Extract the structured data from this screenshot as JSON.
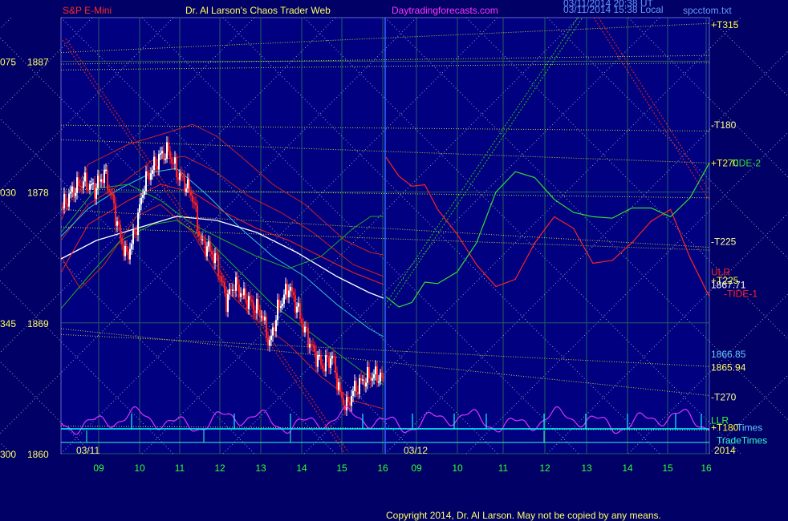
{
  "header": {
    "instrument": "S&P E-Mini",
    "author": "Dr. Al Larson's Chaos Trader Web",
    "site": "Daytradingforecasts.com",
    "stamp_ut": "03/11/2014 20:38 UT",
    "stamp_local": "03/11/2014 15:38 Local",
    "file": "spcctom.txt"
  },
  "footer": {
    "copyright": "Copyright 2014, Dr. Al Larson. May not be copied by any means."
  },
  "colors": {
    "background": "#000066",
    "plot_background": "#000080",
    "title_red": "#ff2a2a",
    "title_yellow": "#ffff66",
    "site_magenta": "#ff33ff",
    "label_yellow": "#ffff33",
    "tick_green": "#33ff33",
    "tide1": "#ff2222",
    "tide2": "#33dd33",
    "cycle": "#dd33ff",
    "trade_times": "#33ffcc",
    "lunar_cyan": "#00ffff"
  },
  "chart_data": {
    "type": "line",
    "y_ticks": [
      {
        "left": "075",
        "price": "1887",
        "value": 1887
      },
      {
        "left": "030",
        "price": "1878",
        "value": 1878
      },
      {
        "left": "345",
        "price": "1869",
        "value": 1869
      },
      {
        "left": "300",
        "price": "1860",
        "value": 1860
      }
    ],
    "ylim": [
      1860,
      1890
    ],
    "x_ticks_day1": [
      "09",
      "10",
      "11",
      "12",
      "13",
      "14",
      "15",
      "16"
    ],
    "x_ticks_day2": [
      "09",
      "10",
      "11",
      "12",
      "13",
      "14",
      "15",
      "16"
    ],
    "date_labels": [
      "03/11",
      "03/12"
    ],
    "year_label": "2014",
    "right_labels": [
      {
        "text": "+T315",
        "price": 1889.5,
        "color": "#ffff33"
      },
      {
        "text": "-T180",
        "price": 1882.6,
        "color": "#ffff99"
      },
      {
        "text": "+T270",
        "price": 1880.0,
        "color": "#ffff33"
      },
      {
        "text": "TIDE-2",
        "price": 1880.0,
        "color": "#33dd33"
      },
      {
        "text": "-T225",
        "price": 1874.6,
        "color": "#ffff99"
      },
      {
        "text": "ULR",
        "price": 1872.5,
        "color": "#ff2222"
      },
      {
        "text": "+T225",
        "price": 1871.9,
        "color": "#ffff33"
      },
      {
        "text": "1867.71",
        "price": 1871.6,
        "color": "#ffffff"
      },
      {
        "text": "-TIDE-1",
        "price": 1871.0,
        "color": "#ff2222"
      },
      {
        "text": "1866.85",
        "price": 1866.85,
        "color": "#66ccff"
      },
      {
        "text": "1865.94",
        "price": 1865.94,
        "color": "#ffff66"
      },
      {
        "text": "-T270",
        "price": 1863.9,
        "color": "#ffff99"
      },
      {
        "text": "LLR",
        "price": 1862.3,
        "color": "#33ff33"
      },
      {
        "text": "+T180",
        "price": 1861.8,
        "color": "#ffff33"
      },
      {
        "text": "Times",
        "price": 1861.8,
        "color": "#66ccff"
      },
      {
        "text": "TradeTimes",
        "price": 1860.9,
        "color": "#33ffcc"
      }
    ],
    "series": [
      {
        "name": "-TIDE-1",
        "color": "#ff2222",
        "x": [
          0.0,
          0.04,
          0.08,
          0.12,
          0.16,
          0.22,
          0.28,
          0.34,
          0.4,
          0.46,
          0.52,
          0.58,
          0.64,
          0.7,
          0.76,
          0.82,
          0.88,
          0.94,
          1.0
        ],
        "values": [
          1880.4,
          1879.1,
          1878.4,
          1878.5,
          1876.8,
          1875.1,
          1873.0,
          1871.5,
          1872.0,
          1874.5,
          1876.3,
          1875.5,
          1873.1,
          1873.3,
          1874.5,
          1876.0,
          1876.8,
          1873.5,
          1870.8
        ]
      },
      {
        "name": "TIDE-2",
        "color": "#33dd33",
        "x": [
          0.0,
          0.04,
          0.08,
          0.12,
          0.16,
          0.22,
          0.28,
          0.34,
          0.4,
          0.46,
          0.52,
          0.58,
          0.64,
          0.7,
          0.76,
          0.82,
          0.88,
          0.94,
          1.0
        ],
        "values": [
          1870.8,
          1870.1,
          1870.4,
          1871.8,
          1871.7,
          1872.5,
          1874.5,
          1878.0,
          1879.4,
          1879.0,
          1877.5,
          1876.6,
          1876.3,
          1876.2,
          1876.9,
          1876.9,
          1876.3,
          1877.6,
          1880.0
        ]
      }
    ],
    "cycle_line": {
      "name": "cycle",
      "color": "#dd33ff"
    },
    "time_lines": [
      "Times",
      "TradeTimes"
    ],
    "grid": true
  }
}
